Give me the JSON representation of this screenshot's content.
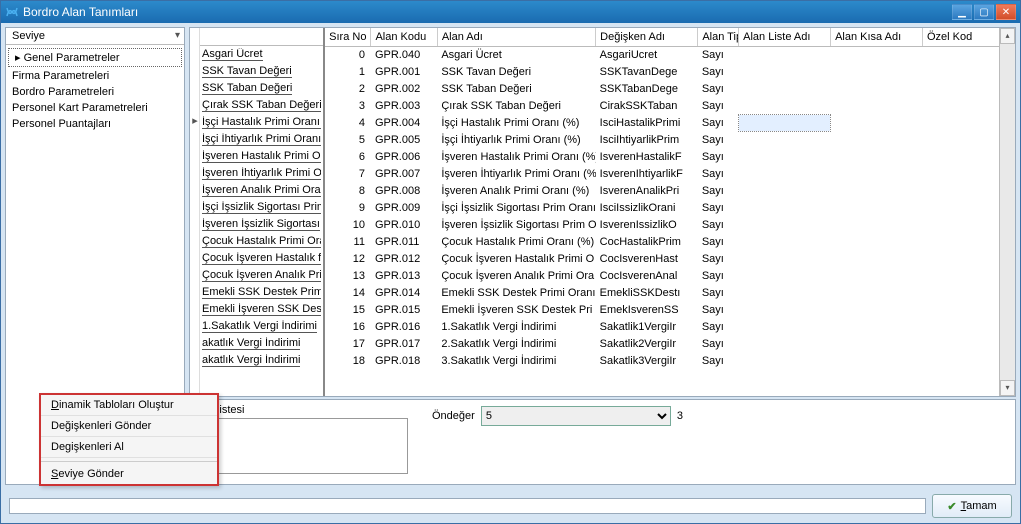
{
  "window": {
    "title": "Bordro Alan Tanımları"
  },
  "sidebar": {
    "head": "Seviye",
    "items": [
      "Genel Parametreler",
      "Firma Parametreleri",
      "Bordro Parametreleri",
      "Personel Kart Parametreleri",
      "Personel Puantajları"
    ]
  },
  "columns": {
    "sira_no": "Sıra No",
    "alan_kodu": "Alan Kodu",
    "alan_adi": "Alan Adı",
    "degisken_adi": "Değişken Adı",
    "alan_tipi": "Alan Tipi",
    "alan_liste_adi": "Alan Liste Adı",
    "alan_kisa_adi": "Alan Kısa Adı",
    "ozel_kod": "Özel Kod"
  },
  "rows": [
    {
      "l": "Asgari Ücret",
      "no": 0,
      "k": "GPR.040",
      "ad": "Asgari Ücret",
      "dg": "AsgariUcret",
      "tp": "Sayı"
    },
    {
      "l": "SSK Tavan Değeri",
      "no": 1,
      "k": "GPR.001",
      "ad": "SSK Tavan Değeri",
      "dg": "SSKTavanDege",
      "tp": "Sayı"
    },
    {
      "l": "SSK Taban Değeri",
      "no": 2,
      "k": "GPR.002",
      "ad": "SSK Taban Değeri",
      "dg": "SSKTabanDege",
      "tp": "Sayı"
    },
    {
      "l": "Çırak SSK Taban Değeri",
      "no": 3,
      "k": "GPR.003",
      "ad": "Çırak SSK Taban Değeri",
      "dg": "CirakSSKTaban",
      "tp": "Sayı"
    },
    {
      "l": "İşçi Hastalık Primi Oranı (",
      "no": 4,
      "k": "GPR.004",
      "ad": "İşçi Hastalık Primi Oranı (%)",
      "dg": "IsciHastalikPrimi",
      "tp": "Sayı",
      "sel": true
    },
    {
      "l": "İşçi İhtiyarlık Primi Oranı",
      "no": 5,
      "k": "GPR.005",
      "ad": "İşçi İhtiyarlık Primi Oranı (%)",
      "dg": "IsciIhtiyarlikPrim",
      "tp": "Sayı"
    },
    {
      "l": "İşveren Hastalık Primi Or",
      "no": 6,
      "k": "GPR.006",
      "ad": "İşveren Hastalık Primi Oranı (%)",
      "dg": "IsverenHastalikF",
      "tp": "Sayı"
    },
    {
      "l": "İşveren İhtiyarlık Primi O",
      "no": 7,
      "k": "GPR.007",
      "ad": "İşveren İhtiyarlık Primi Oranı (%)",
      "dg": "IsverenIhtiyarlikF",
      "tp": "Sayı"
    },
    {
      "l": "İşveren Analık Primi  Ora",
      "no": 8,
      "k": "GPR.008",
      "ad": "İşveren Analık Primi  Oranı (%)",
      "dg": "IsverenAnalikPri",
      "tp": "Sayı"
    },
    {
      "l": "İşçi İşsizlik Sigortası Prim",
      "no": 9,
      "k": "GPR.009",
      "ad": "İşçi İşsizlik Sigortası Prim Oranı",
      "dg": "IsciIssizlikOrani",
      "tp": "Sayı"
    },
    {
      "l": "İşveren İşsizlik Sigortası",
      "no": 10,
      "k": "GPR.010",
      "ad": "İşveren İşsizlik Sigortası Prim O",
      "dg": "IsverenIssizlikO",
      "tp": "Sayı"
    },
    {
      "l": "Çocuk Hastalık Primi Ora",
      "no": 11,
      "k": "GPR.011",
      "ad": "Çocuk Hastalık Primi Oranı (%)",
      "dg": "CocHastalikPrim",
      "tp": "Sayı"
    },
    {
      "l": "Çocuk İşveren Hastalık f",
      "no": 12,
      "k": "GPR.012",
      "ad": "Çocuk İşveren Hastalık Primi O",
      "dg": "CocIsverenHast",
      "tp": "Sayı"
    },
    {
      "l": "Çocuk İşveren Analık Pri",
      "no": 13,
      "k": "GPR.013",
      "ad": "Çocuk İşveren Analık Primi  Ora",
      "dg": "CocIsverenAnal",
      "tp": "Sayı"
    },
    {
      "l": "Emekli SSK Destek Primi O",
      "no": 14,
      "k": "GPR.014",
      "ad": "Emekli SSK Destek Primi Oranı",
      "dg": "EmekliSSKDestı",
      "tp": "Sayı"
    },
    {
      "l": "Emekli İşveren SSK Dest",
      "no": 15,
      "k": "GPR.015",
      "ad": "Emekli İşveren SSK Destek Pri",
      "dg": "EmekIsverenSS",
      "tp": "Sayı"
    },
    {
      "l": "1.Sakatlık Vergi İndirimi",
      "no": 16,
      "k": "GPR.016",
      "ad": "1.Sakatlık Vergi İndirimi",
      "dg": "Sakatlik1VergiIr",
      "tp": "Sayı"
    },
    {
      "l": "akatlık Vergi İndirimi",
      "no": 17,
      "k": "GPR.017",
      "ad": "2.Sakatlık Vergi İndirimi",
      "dg": "Sakatlik2VergiIr",
      "tp": "Sayı"
    },
    {
      "l": "akatlık Vergi İndirimi",
      "no": 18,
      "k": "GPR.018",
      "ad": "3.Sakatlık Vergi İndirimi",
      "dg": "Sakatlik3VergiIr",
      "tp": "Sayı"
    }
  ],
  "bottom": {
    "left_label": "jer Listesi",
    "ondeger_label": "Öndeğer",
    "ondeger_value": "5",
    "ondeger_extra": "3"
  },
  "context_menu": {
    "items": [
      "Dinamik Tabloları Oluştur",
      "Değişkenleri Gönder",
      "Degişkenleri Al",
      "Seviye Gönder"
    ]
  },
  "footer": {
    "ok_label": "Tamam"
  }
}
